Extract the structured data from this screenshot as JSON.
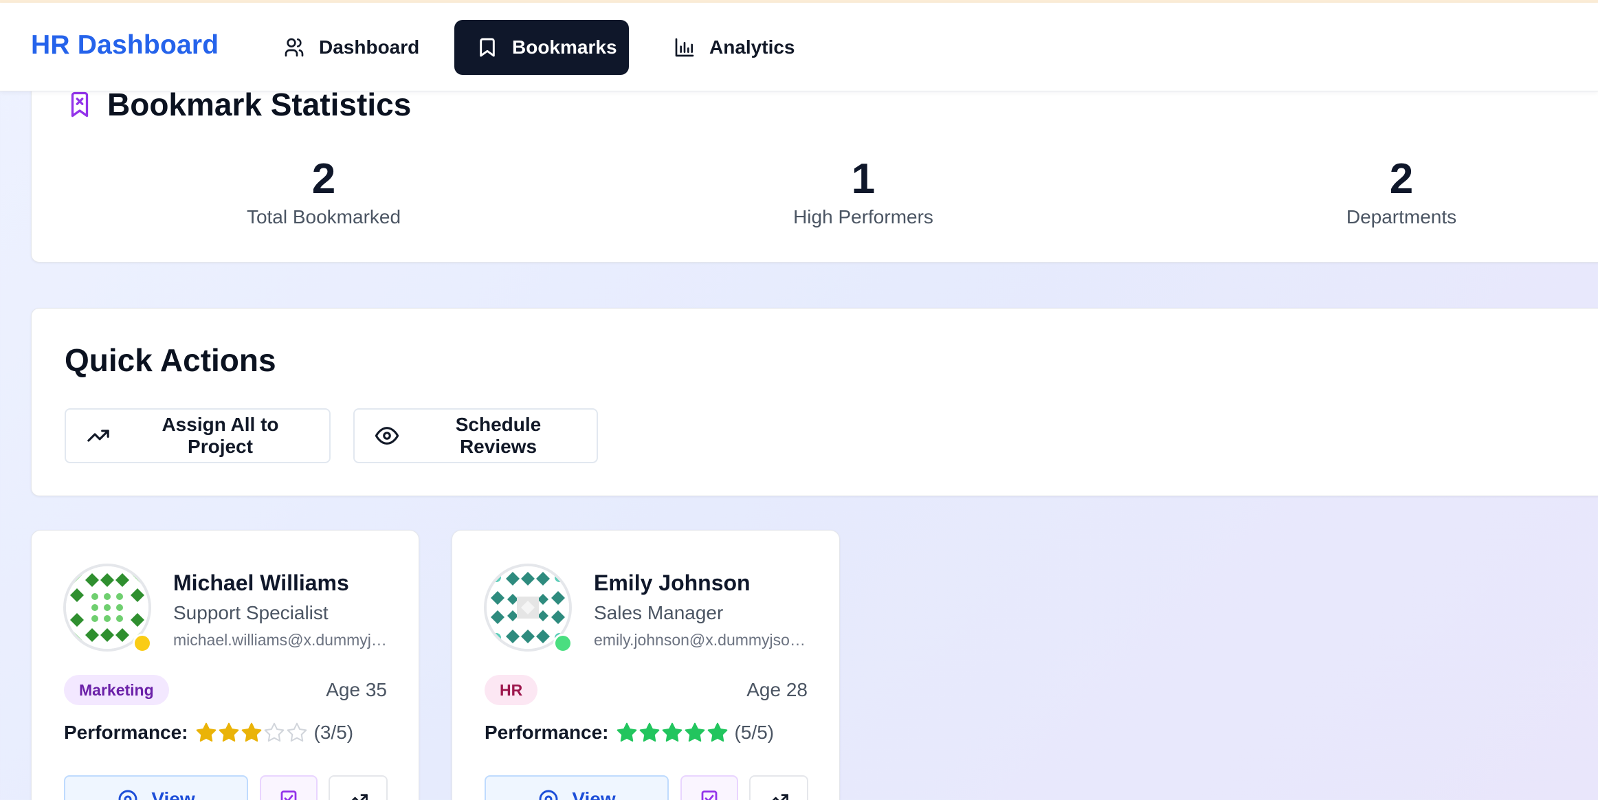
{
  "app": {
    "title": "HR Dashboard"
  },
  "nav": {
    "items": [
      {
        "label": "Dashboard",
        "icon": "users-icon",
        "active": false
      },
      {
        "label": "Bookmarks",
        "icon": "bookmark-icon",
        "active": true
      },
      {
        "label": "Analytics",
        "icon": "bar-chart-icon",
        "active": false
      }
    ]
  },
  "stats": {
    "title": "Bookmark Statistics",
    "icon": "bookmark-x-icon",
    "items": [
      {
        "value": "2",
        "label": "Total Bookmarked"
      },
      {
        "value": "1",
        "label": "High Performers"
      },
      {
        "value": "2",
        "label": "Departments"
      }
    ]
  },
  "quick_actions": {
    "title": "Quick Actions",
    "buttons": [
      {
        "label": "Assign All to Project",
        "icon": "trending-up-icon"
      },
      {
        "label": "Schedule Reviews",
        "icon": "eye-icon"
      }
    ]
  },
  "employees": [
    {
      "name": "Michael Williams",
      "role": "Support Specialist",
      "email": "michael.williams@x.dummyjson.com",
      "department": "Marketing",
      "age_label": "Age 35",
      "performance_label": "Performance:",
      "rating": 3,
      "rating_max": 5,
      "rating_text": "(3/5)",
      "status_color": "#facc15",
      "star_color": "#eab308",
      "badge_bg": "#f3e8ff",
      "badge_color": "#6b21a8",
      "view_label": "View"
    },
    {
      "name": "Emily Johnson",
      "role": "Sales Manager",
      "email": "emily.johnson@x.dummyjson.com",
      "department": "HR",
      "age_label": "Age 28",
      "performance_label": "Performance:",
      "rating": 5,
      "rating_max": 5,
      "rating_text": "(5/5)",
      "status_color": "#4ade80",
      "star_color": "#22c55e",
      "badge_bg": "#fce7f3",
      "badge_color": "#9d174d",
      "view_label": "View"
    }
  ],
  "colors": {
    "brand": "#2563eb",
    "nav_active_bg": "#0f172a",
    "bookmark_accent": "#9333ea"
  }
}
